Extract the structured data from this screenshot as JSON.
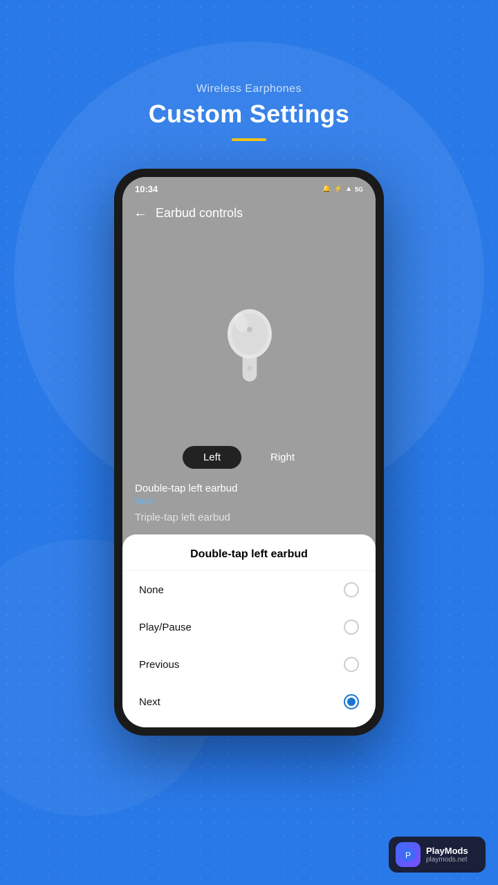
{
  "page": {
    "background_color": "#2979e8"
  },
  "header": {
    "subtitle": "Wireless Earphones",
    "title": "Custom Settings",
    "underline_color": "#f5c518"
  },
  "phone": {
    "status_bar": {
      "time": "10:34",
      "icons": "🔔 🔕 ☁ 🎵 📶 ✈ 5G"
    },
    "app_bar": {
      "back_icon": "←",
      "title": "Earbud controls"
    },
    "toggle": {
      "left_label": "Left",
      "right_label": "Right",
      "active": "left"
    },
    "controls": {
      "double_tap_title": "Double-tap left earbud",
      "double_tap_value": "Next",
      "triple_tap_partial": "Triple-tap left earbud"
    },
    "bottom_sheet": {
      "title": "Double-tap left earbud",
      "options": [
        {
          "id": "none",
          "label": "None",
          "selected": false
        },
        {
          "id": "play-pause",
          "label": "Play/Pause",
          "selected": false
        },
        {
          "id": "previous",
          "label": "Previous",
          "selected": false
        },
        {
          "id": "next",
          "label": "Next",
          "selected": true
        }
      ]
    }
  },
  "playmods": {
    "name": "PlayMods",
    "url": "playmods.net",
    "icon": "🎮"
  }
}
